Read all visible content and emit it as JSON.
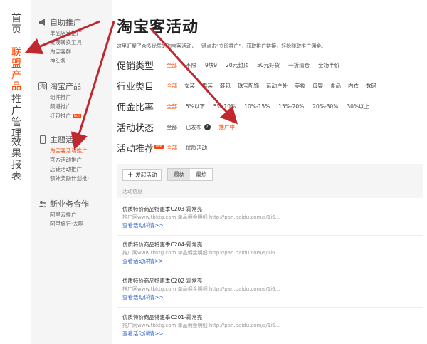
{
  "leftnav": {
    "items": [
      {
        "label": "首页",
        "active": false
      },
      {
        "label": "联盟产品",
        "active": true
      },
      {
        "label": "推广管理",
        "active": false
      },
      {
        "label": "效果报表",
        "active": false
      }
    ]
  },
  "subnav": {
    "groups": [
      {
        "title": "自助推广",
        "icon": "megaphone-icon",
        "items": [
          {
            "label": "单品店铺推广"
          },
          {
            "label": "链接转换工具"
          },
          {
            "label": "淘宝客群"
          },
          {
            "label": "神头条"
          }
        ]
      },
      {
        "title": "淘宝产品",
        "icon": "taobao-icon",
        "items": [
          {
            "label": "组件推广"
          },
          {
            "label": "频道推广"
          },
          {
            "label": "红包推广",
            "badge": "hot"
          }
        ]
      },
      {
        "title": "主题活动",
        "icon": "phone-icon",
        "items": [
          {
            "label": "淘宝客活动推广",
            "active": true
          },
          {
            "label": "官方活动推广"
          },
          {
            "label": "店铺活动推广"
          },
          {
            "label": "额外奖励计划推广"
          }
        ]
      },
      {
        "title": "新业务合作",
        "icon": "group-icon",
        "items": [
          {
            "label": "阿里云推广"
          },
          {
            "label": "阿里旅行·去啊"
          }
        ]
      }
    ]
  },
  "main": {
    "title": "淘宝客活动",
    "description": "这里汇聚了众多优质的淘宝客活动，一键点击“立即推广”，获取推广链接，轻松赚取推广佣金。",
    "filters": [
      {
        "label": "促销类型",
        "options": [
          "全部",
          "不限",
          "9块9",
          "20元封顶",
          "50元好货",
          "一折清仓",
          "全场半价"
        ],
        "selected": 0
      },
      {
        "label": "行业类目",
        "options": [
          "全部",
          "女装",
          "男装",
          "鞋包",
          "珠宝配饰",
          "运动户外",
          "美妆",
          "母婴",
          "食品",
          "内衣",
          "数码"
        ],
        "selected": 0
      },
      {
        "label": "佣金比率",
        "options": [
          "全部",
          "5%以下",
          "5%-10%",
          "10%-15%",
          "15%-20%",
          "20%-30%",
          "30%以上"
        ],
        "selected": 0
      },
      {
        "label": "活动状态",
        "options": [
          "全部",
          "已发布",
          "推广中"
        ],
        "selected": 2
      },
      {
        "label": "活动推荐",
        "badge": "new",
        "options": [
          "全部",
          "优质活动"
        ],
        "selected": 0
      }
    ],
    "toolbar": {
      "create_label": "发起活动",
      "sort_options": [
        "最新",
        "最热"
      ],
      "sort_selected": 0
    },
    "list_header": "活动信息",
    "activities": [
      {
        "title": "优质特价商品特惠季C203-霜常亮",
        "meta": "推广网www.tbktg.com 单品佣金明细 http://pan.baidu.com/s/1i6...",
        "link": "查看活动详情>>"
      },
      {
        "title": "优质特价商品特惠季C204-霜常亮",
        "meta": "推广网www.tbktg.com 单品佣金明细 http://pan.baidu.com/s/1i6...",
        "link": "查看活动详情>>"
      },
      {
        "title": "优质特价商品特惠季C202-霜常亮",
        "meta": "推广网www.tbktg.com 单品佣金明细 http://pan.baidu.com/s/1i6...",
        "link": "查看活动详情>>"
      },
      {
        "title": "优质特价商品特惠季C201-霜常亮",
        "meta": "推广网www.tbktg.com 单品佣金明细 http://pan.baidu.com/s/1i6...",
        "link": "查看活动详情>>"
      }
    ]
  },
  "colors": {
    "accent": "#ff4400",
    "link": "#3366cc",
    "arrow": "#c0282d"
  }
}
